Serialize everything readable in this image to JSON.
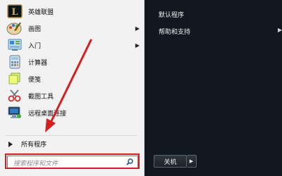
{
  "left_panel": {
    "programs": [
      {
        "label": "英雄联盟",
        "icon": "lol-icon",
        "has_submenu": false
      },
      {
        "label": "画图",
        "icon": "paint-icon",
        "has_submenu": true
      },
      {
        "label": "入门",
        "icon": "getting-started-icon",
        "has_submenu": true
      },
      {
        "label": "计算器",
        "icon": "calculator-icon",
        "has_submenu": false
      },
      {
        "label": "便笺",
        "icon": "sticky-notes-icon",
        "has_submenu": false
      },
      {
        "label": "截图工具",
        "icon": "snipping-tool-icon",
        "has_submenu": false
      },
      {
        "label": "远程桌面连接",
        "icon": "remote-desktop-icon",
        "has_submenu": false
      }
    ],
    "all_programs_label": "所有程序",
    "search": {
      "placeholder": "搜索程序和文件"
    }
  },
  "right_panel": {
    "links": [
      {
        "label": "默认程序",
        "has_submenu": false
      },
      {
        "label": "帮助和支持",
        "has_submenu": true
      }
    ],
    "shutdown_label": "关机"
  },
  "annotation": {
    "color": "#d62020"
  }
}
